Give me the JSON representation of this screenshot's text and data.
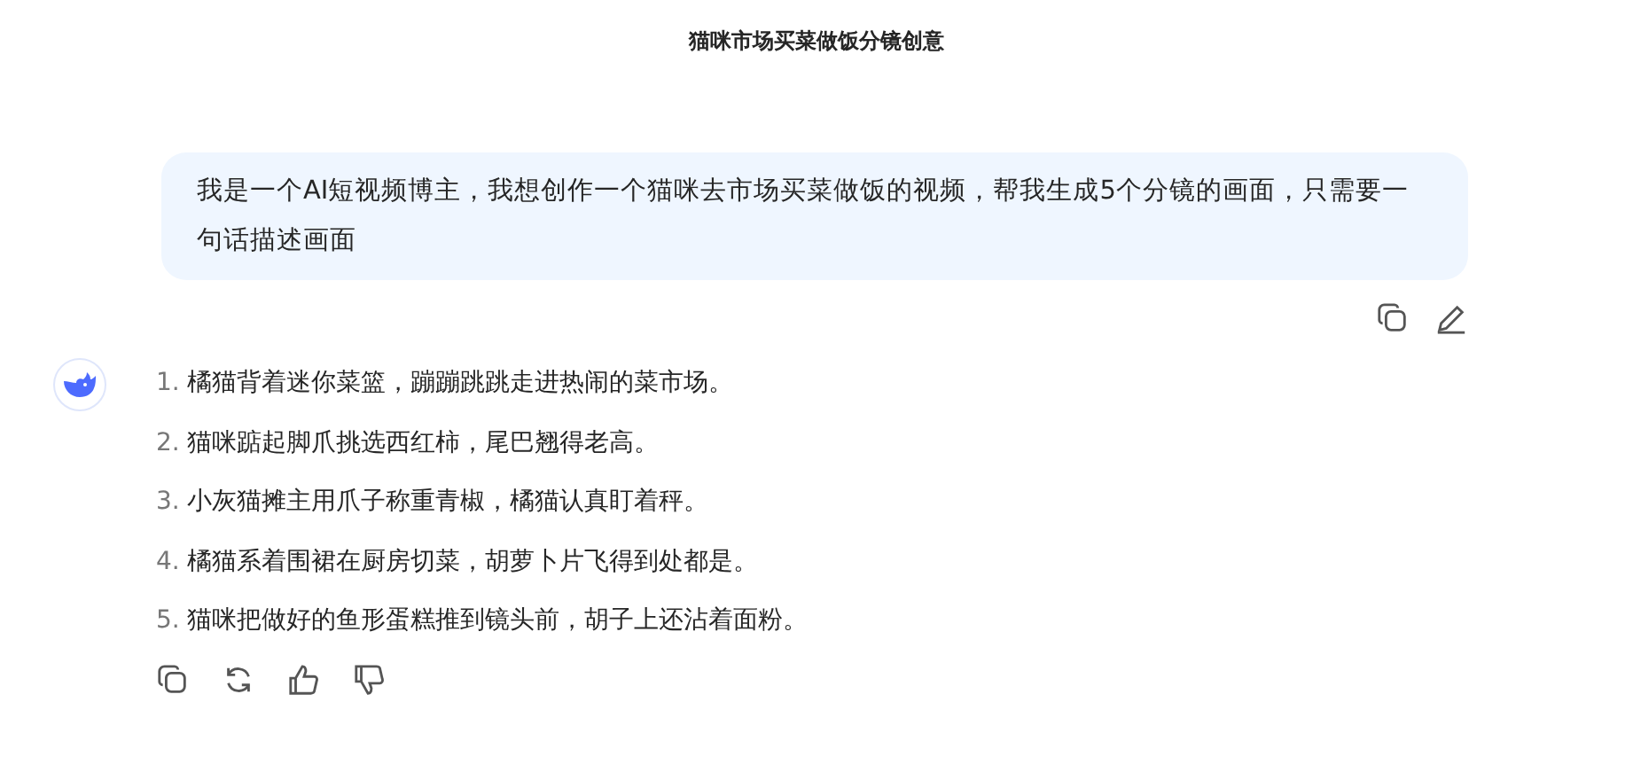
{
  "title": "猫咪市场买菜做饭分镜创意",
  "user_message": {
    "text": "我是一个AI短视频博主，我想创作一个猫咪去市场买菜做饭的视频，帮我生成5个分镜的画面，只需要一句话描述画面"
  },
  "reply": {
    "items": [
      {
        "number": "1.",
        "text": "橘猫背着迷你菜篮，蹦蹦跳跳走进热闹的菜市场。"
      },
      {
        "number": "2.",
        "text": "猫咪踮起脚爪挑选西红柿，尾巴翘得老高。"
      },
      {
        "number": "3.",
        "text": "小灰猫摊主用爪子称重青椒，橘猫认真盯着秤。"
      },
      {
        "number": "4.",
        "text": "橘猫系着围裙在厨房切菜，胡萝卜片飞得到处都是。"
      },
      {
        "number": "5.",
        "text": "猫咪把做好的鱼形蛋糕推到镜头前，胡子上还沾着面粉。"
      }
    ]
  }
}
